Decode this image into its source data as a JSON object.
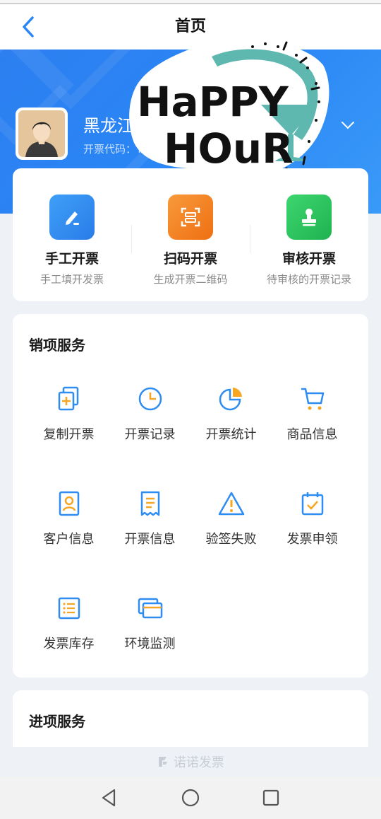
{
  "header": {
    "title": "首页"
  },
  "profile": {
    "company_name": "黑龙江",
    "code_label": "开票代码：TC"
  },
  "sticker": {
    "text_line1": "HaPPY",
    "text_line2": "HOuR"
  },
  "quick_actions": [
    {
      "title": "手工开票",
      "subtitle": "手工填开发票",
      "icon": "pencil-icon",
      "color": "#2f8cf0"
    },
    {
      "title": "扫码开票",
      "subtitle": "生成开票二维码",
      "icon": "scan-icon",
      "color": "#f0791f"
    },
    {
      "title": "审核开票",
      "subtitle": "待审核的开票记录",
      "icon": "stamp-icon",
      "color": "#22c25a"
    }
  ],
  "sales_section": {
    "title": "销项服务",
    "items": [
      {
        "label": "复制开票",
        "icon": "copy-doc-icon"
      },
      {
        "label": "开票记录",
        "icon": "clock-icon"
      },
      {
        "label": "开票统计",
        "icon": "pie-chart-icon"
      },
      {
        "label": "商品信息",
        "icon": "cart-icon"
      },
      {
        "label": "客户信息",
        "icon": "contact-card-icon"
      },
      {
        "label": "开票信息",
        "icon": "receipt-icon"
      },
      {
        "label": "验签失败",
        "icon": "warning-icon"
      },
      {
        "label": "发票申领",
        "icon": "calendar-check-icon"
      },
      {
        "label": "发票库存",
        "icon": "list-icon"
      },
      {
        "label": "环境监测",
        "icon": "cards-icon"
      }
    ]
  },
  "purchase_section": {
    "title": "进项服务"
  },
  "footer": {
    "brand": "诺诺发票"
  },
  "colors": {
    "primary": "#2a86f5",
    "icon_blue": "#2f8cf0",
    "icon_orange": "#f5a623"
  }
}
